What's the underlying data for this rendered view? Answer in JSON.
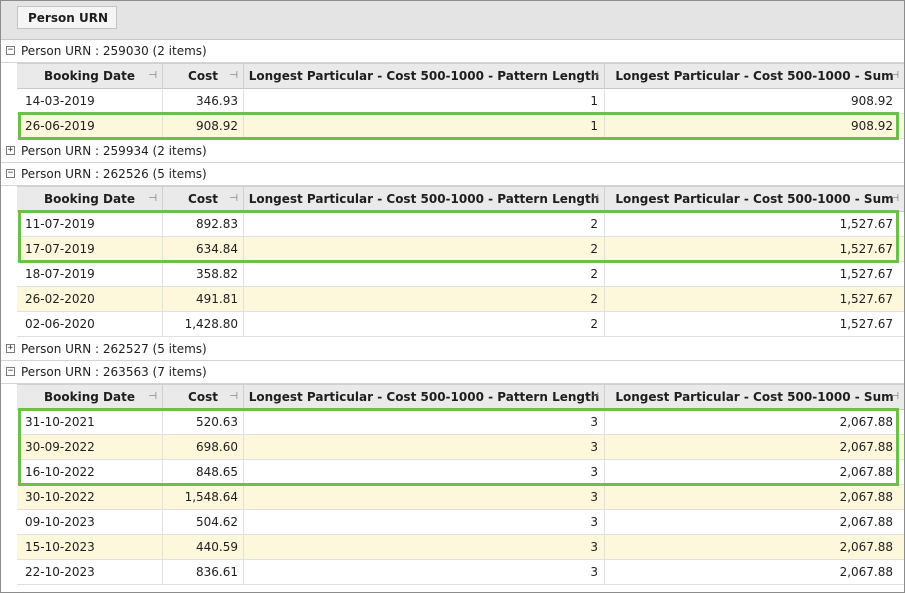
{
  "group_panel": {
    "chip_label": "Person URN"
  },
  "columns": [
    "Booking Date",
    "Cost",
    "Longest Particular - Cost 500-1000 - Pattern Length",
    "Longest Particular - Cost 500-1000 - Sum"
  ],
  "icons": {
    "expanded": "minus-expander-icon",
    "collapsed": "plus-expander-icon",
    "column_pin": "pin-icon"
  },
  "colors": {
    "alt_row": "#fdf7dc",
    "highlight": "#6cbf4a"
  },
  "groups": [
    {
      "label": "Person URN : 259030 (2 items)",
      "expanded": true,
      "expander": "−",
      "rows": [
        [
          "14-03-2019",
          "346.93",
          "1",
          "908.92"
        ],
        [
          "26-06-2019",
          "908.92",
          "1",
          "908.92"
        ]
      ]
    },
    {
      "label": "Person URN : 259934 (2 items)",
      "expanded": false,
      "expander": "+",
      "rows": []
    },
    {
      "label": "Person URN : 262526 (5 items)",
      "expanded": true,
      "expander": "−",
      "rows": [
        [
          "11-07-2019",
          "892.83",
          "2",
          "1,527.67"
        ],
        [
          "17-07-2019",
          "634.84",
          "2",
          "1,527.67"
        ],
        [
          "18-07-2019",
          "358.82",
          "2",
          "1,527.67"
        ],
        [
          "26-02-2020",
          "491.81",
          "2",
          "1,527.67"
        ],
        [
          "02-06-2020",
          "1,428.80",
          "2",
          "1,527.67"
        ]
      ]
    },
    {
      "label": "Person URN : 262527 (5 items)",
      "expanded": false,
      "expander": "+",
      "rows": []
    },
    {
      "label": "Person URN : 263563 (7 items)",
      "expanded": true,
      "expander": "−",
      "rows": [
        [
          "31-10-2021",
          "520.63",
          "3",
          "2,067.88"
        ],
        [
          "30-09-2022",
          "698.60",
          "3",
          "2,067.88"
        ],
        [
          "16-10-2022",
          "848.65",
          "3",
          "2,067.88"
        ],
        [
          "30-10-2022",
          "1,548.64",
          "3",
          "2,067.88"
        ],
        [
          "09-10-2023",
          "504.62",
          "3",
          "2,067.88"
        ],
        [
          "15-10-2023",
          "440.59",
          "3",
          "2,067.88"
        ],
        [
          "22-10-2023",
          "836.61",
          "3",
          "2,067.88"
        ]
      ]
    }
  ]
}
